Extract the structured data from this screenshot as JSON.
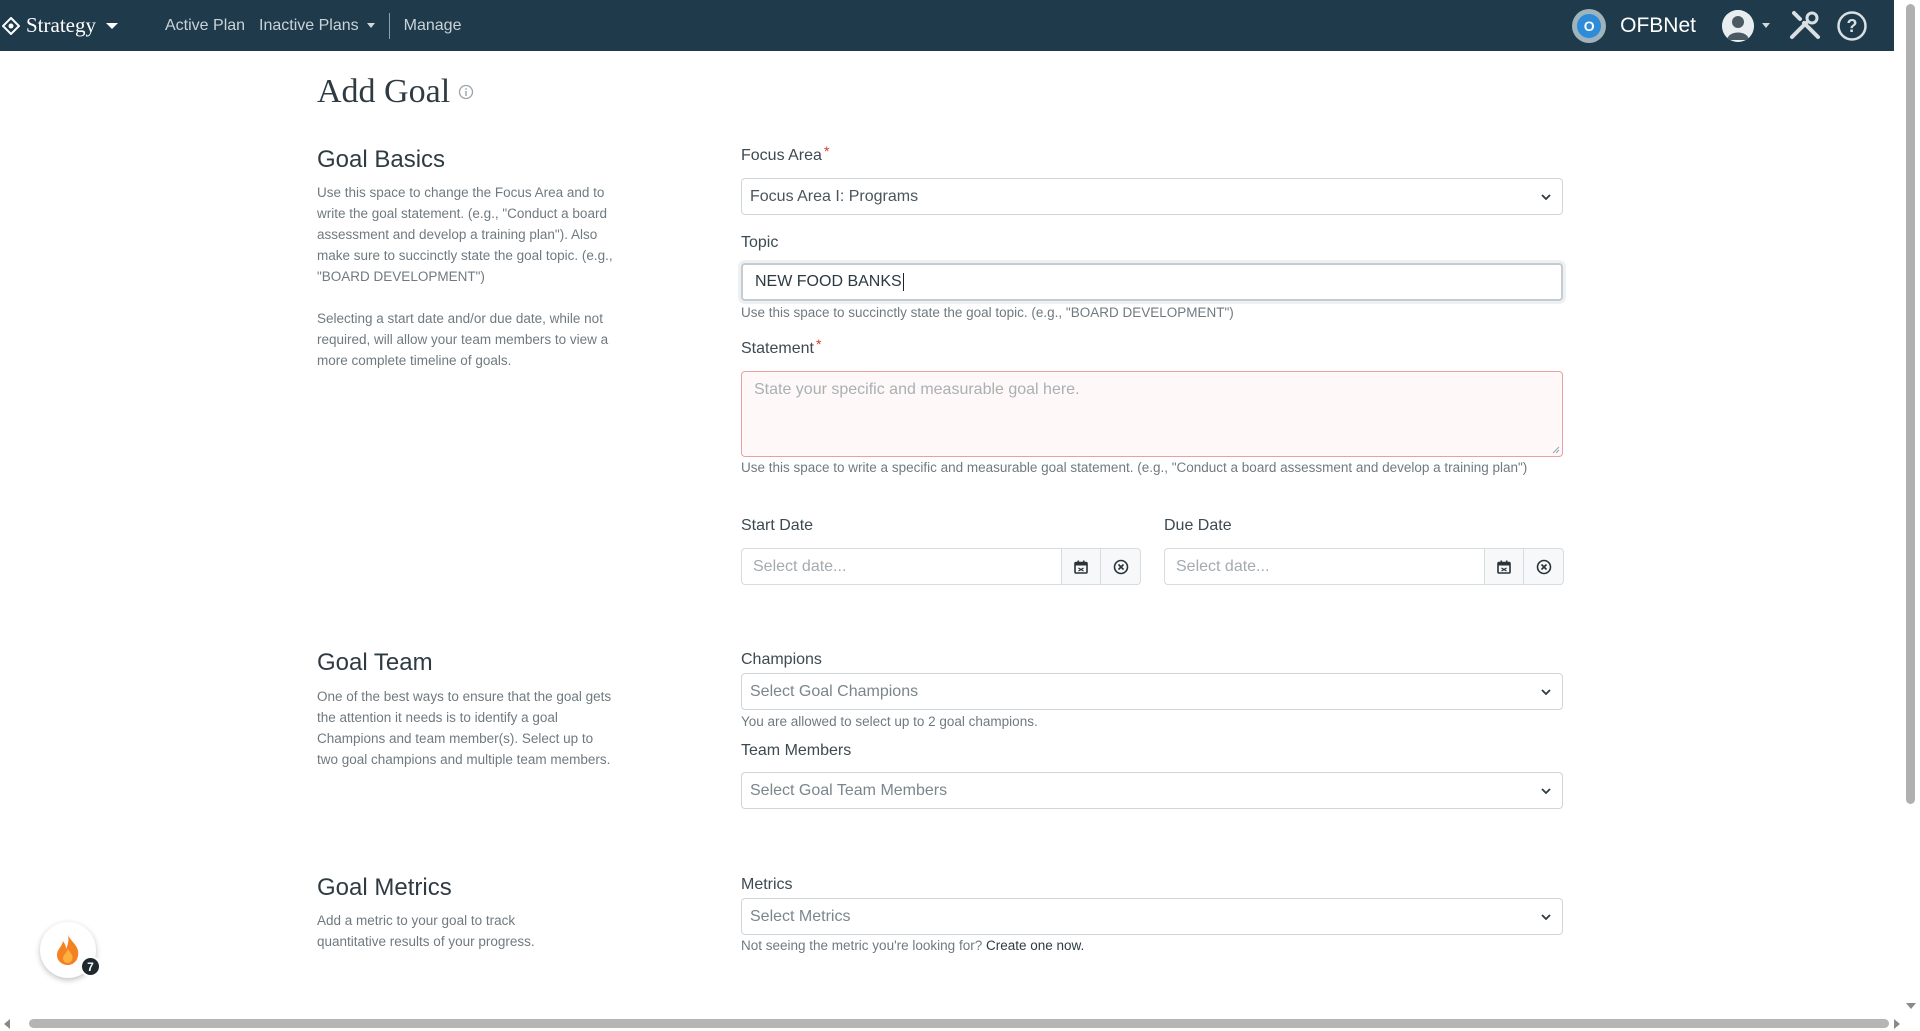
{
  "navbar": {
    "brand": "Strategy",
    "links": [
      "Active Plan",
      "Inactive Plans",
      "Manage"
    ],
    "org_badge_letter": "O",
    "org_name": "OFBNet",
    "icons": [
      "strategy-diamond-icon",
      "user-avatar-icon",
      "tools-icon",
      "help-circle-icon"
    ]
  },
  "page": {
    "title": "Add Goal"
  },
  "basics": {
    "title": "Goal Basics",
    "desc1": "Use this space to change the Focus Area and to write the goal statement. (e.g., \"Conduct a board assessment and develop a training plan\"). Also make sure to succinctly state the goal topic. (e.g., \"BOARD DEVELOPMENT\")",
    "desc2": "Selecting a start date and/or due date, while not required, will allow your team members to view a more complete timeline of goals.",
    "focus_area_label": "Focus Area",
    "focus_area_value": "Focus Area I: Programs",
    "required_mark": "*",
    "topic_label": "Topic",
    "topic_value": "NEW FOOD BANKS",
    "topic_help": "Use this space to succinctly state the goal topic. (e.g., \"BOARD DEVELOPMENT\")",
    "statement_label": "Statement",
    "statement_placeholder": "State your specific and measurable goal here.",
    "statement_help": "Use this space to write a specific and measurable goal statement. (e.g., \"Conduct a board assessment and develop a training plan\")",
    "start_date_label": "Start Date",
    "due_date_label": "Due Date",
    "date_placeholder": "Select date..."
  },
  "team": {
    "title": "Goal Team",
    "desc": "One of the best ways to ensure that the goal gets the attention it needs is to identify a goal Champions and team member(s). Select up to two goal champions and multiple team members.",
    "champions_label": "Champions",
    "champions_placeholder": "Select Goal Champions",
    "champions_help": "You are allowed to select up to 2 goal champions.",
    "members_label": "Team Members",
    "members_placeholder": "Select Goal Team Members"
  },
  "metrics": {
    "title": "Goal Metrics",
    "desc": "Add a metric to your goal to track quantitative results of your progress.",
    "label": "Metrics",
    "placeholder": "Select Metrics",
    "help_prefix": "Not seeing the metric you're looking for?",
    "help_link": "Create one now."
  },
  "widget": {
    "count": "7"
  },
  "colors": {
    "navbar": "#1f3a4a",
    "required": "#d9392f",
    "error_border": "#e8a0a0",
    "badge_blue": "#2d8bd8",
    "fire_orange": "#f58220"
  }
}
